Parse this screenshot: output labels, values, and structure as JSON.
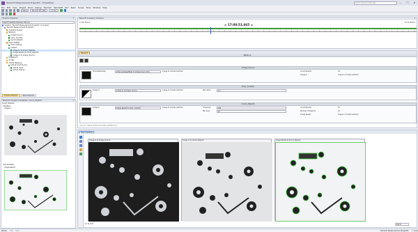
{
  "window": {
    "title": "TwinCAT Measurement Project01 - TcXaeShell",
    "search": "Quick Launch (Ctrl+Q)",
    "min": "—",
    "max": "☐",
    "close": "✕"
  },
  "menu": [
    "File",
    "Edit",
    "View",
    "Project",
    "Build",
    "Debug",
    "TwinCAT",
    "TwinSAFE",
    "PLC",
    "Team",
    "Scope",
    "Tools",
    "Window",
    "Help"
  ],
  "toolbar": {
    "config": "Debug",
    "platform": "TwinCAT RT (x64)",
    "target": "<Local>"
  },
  "solution_explorer": {
    "title": "Solution Explorer",
    "search": "Search Solution Explorer (Ctrl+ü)",
    "items": [
      {
        "label": "Solution 'TwinCAT Measurement Project01' (1 project)",
        "depth": 0
      },
      {
        "label": "TwinCAT Measurement Project01",
        "depth": 1
      },
      {
        "label": "Analytics Project",
        "depth": 2
      },
      {
        "label": "Network",
        "depth": 2
      },
      {
        "label": "Image_Source",
        "depth": 3
      },
      {
        "label": "Color_Inverter",
        "depth": 3
      },
      {
        "label": "Count_Objects",
        "depth": 3
      },
      {
        "label": "Vision Buffers",
        "depth": 2
      },
      {
        "label": "Vision Debug",
        "depth": 3
      },
      {
        "label": "Images",
        "depth": 3
      },
      {
        "label": "Image In @ Count_Objects",
        "depth": 4
      },
      {
        "label": "Image Result @ Count_Objects",
        "depth": 4
      },
      {
        "label": "Image In @ Image_Source",
        "depth": 4
      },
      {
        "label": "Dashboard",
        "depth": 2
      },
      {
        "label": "Scripts",
        "depth": 2
      },
      {
        "label": "Virtual Mapping",
        "depth": 2
      },
      {
        "label": "Virtual Input Source",
        "depth": 3
      },
      {
        "label": "Virtual Input",
        "depth": 4
      },
      {
        "label": "Virtual Output",
        "depth": 4
      }
    ],
    "tabs": [
      "Solution Explorer",
      "Team Explorer"
    ]
  },
  "variables_panel": {
    "title": "TwinCAT Analytics Variables: Count_Objects",
    "node": "Count_Objects",
    "groups": [
      "Variables",
      "Image In",
      "Out Variables",
      "Image Result"
    ]
  },
  "timeline": {
    "title": "TwinCAT Analytics Timeline",
    "start": "17:00:39,512",
    "time": "= 17:00:51,665 =",
    "end": "17:01:09,512"
  },
  "network_editor": {
    "tab": "Network",
    "header": "Network",
    "status": "edit: Ab...9d4ab-2036-4370-8d63-a3490fcc4a1",
    "nodes": [
      {
        "title": "Image_Source",
        "in_label": "SimulatedImage",
        "in_value": "Initial packageHDdp @ Virtual Input_Virtu...",
        "in_note": "image to module switcher",
        "outs": [
          [
            "Count Results",
            "91"
          ],
          [
            "Image In",
            "image in module switcher"
          ]
        ]
      },
      {
        "title": "Color_Inverter",
        "in_label": "Image In",
        "in_value": "Image In @ Image_Source",
        "in_note": "image to module switcher",
        "params": [
          [
            "Max Value",
            "1.0"
          ]
        ]
      },
      {
        "title": "Count_Objects",
        "in_label": "Image In",
        "in_value": "Image Result @ Color_Inverter",
        "in_note": "image to module switcher",
        "params": [
          [
            "Threshold",
            "100"
          ],
          [
            "Min Area",
            "10"
          ]
        ],
        "outs": [
          [
            "Count Results",
            "91"
          ],
          [
            "Number Of Objects",
            "16"
          ],
          [
            "Image Result",
            "image in module switcher"
          ]
        ]
      }
    ]
  },
  "vision_debug": {
    "tab": "Vision Debug",
    "images": [
      {
        "title": "Image In @ Image_Source",
        "style": "dark"
      },
      {
        "title": "Image In @ Count_Objects",
        "style": "light"
      },
      {
        "title": "Image Result @ Count_Objects",
        "style": "result"
      }
    ],
    "zoom": "100 %",
    "pixel": "(0, 0) 0.00"
  },
  "status": {
    "items": [
      "Ready",
      "↑ 0",
      "✎ 0",
      "TwinCAT Measurement Project01",
      "⚐ main"
    ]
  },
  "colors": {
    "accent": "#6b4fa0",
    "tab_active": "#fde7a5",
    "result_green": "#39c439",
    "tree_select": "#cde3fb"
  }
}
